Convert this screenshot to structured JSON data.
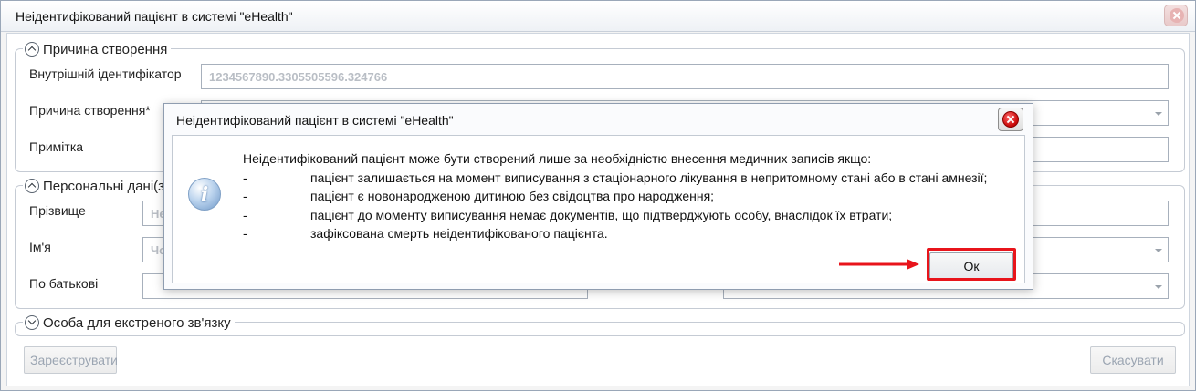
{
  "window": {
    "title": "Неідентифікований пацієнт в системі \"eHealth\""
  },
  "form": {
    "section_reason": {
      "title": "Причина створення",
      "internal_id_label": "Внутрішній ідентифікатор",
      "internal_id_value": "1234567890.3305505596.324766",
      "reason_label": "Причина створення*",
      "note_label": "Примітка"
    },
    "section_personal": {
      "title": "Персональні дані(з",
      "surname_label": "Прізвище",
      "surname_value": "Не",
      "name_label": "Ім'я",
      "name_value": "Чо",
      "patronymic_label": "По батькові"
    },
    "section_contact": {
      "title": "Особа для екстреного зв'язку"
    },
    "register_label": "Зареєструвати",
    "cancel_label": "Скасувати"
  },
  "dialog": {
    "title": "Неідентифікований пацієнт в системі \"eHealth\"",
    "intro": "Неідентифікований пацієнт може бути створений лише за необхідністю внесення медичних записів якщо:",
    "items": [
      {
        "dash": "-",
        "text": "пацієнт залишається на момент виписування з стаціонарного лікування в непритомному стані або в стані амнезії;"
      },
      {
        "dash": "-",
        "text": "пацієнт є новонародженою дитиною без свідоцтва про народження;"
      },
      {
        "dash": "-",
        "text": "пацієнт до моменту виписування немає документів, що підтверджують особу, внаслідок їх втрати;"
      },
      {
        "dash": "-",
        "text": "зафіксована смерть неідентифікованого пацієнта."
      }
    ],
    "ok_label": "Ок",
    "icon": "info-icon"
  },
  "colors": {
    "highlight": "#e8141b",
    "dialog_border": "#8f9db0"
  }
}
